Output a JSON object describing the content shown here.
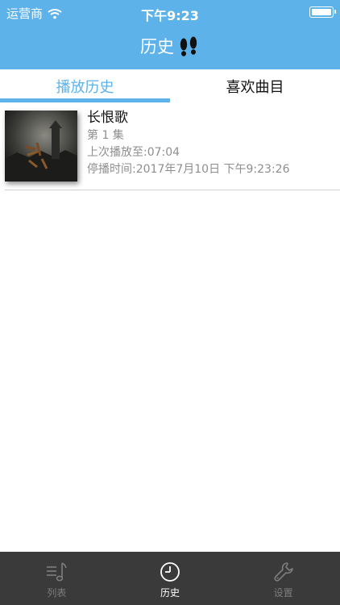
{
  "status": {
    "carrier": "运营商",
    "time": "下午9:23",
    "wifi_icon": "wifi-icon",
    "battery_icon": "battery-icon"
  },
  "nav": {
    "title": "历史",
    "icon": "footprints-icon"
  },
  "segments": [
    {
      "label": "播放历史",
      "active": true
    },
    {
      "label": "喜欢曲目",
      "active": false
    }
  ],
  "history": [
    {
      "title": "长恨歌",
      "episode": "第 1 集",
      "last_played": "上次播放至:07:04",
      "stopped_at": "停播时间:2017年7月10日 下午9:23:26"
    }
  ],
  "tabs": [
    {
      "label": "列表",
      "icon": "music-list-icon",
      "active": false
    },
    {
      "label": "历史",
      "icon": "clock-icon",
      "active": true
    },
    {
      "label": "设置",
      "icon": "wrench-icon",
      "active": false
    }
  ],
  "colors": {
    "accent": "#5db2ea",
    "tabbar": "#3a3a3a",
    "meta_text": "#8e8e8e"
  }
}
